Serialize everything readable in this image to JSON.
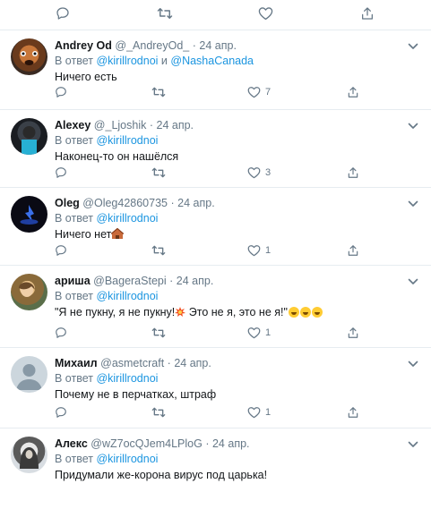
{
  "colors": {
    "accent": "#1b95e0",
    "muted": "#657786",
    "text": "#14171a",
    "divider": "#e6ecf0"
  },
  "tweets": [
    {
      "name": "Andrey Od",
      "handle": "@_AndreyOd_",
      "date": "24 апр.",
      "reply_prefix": "В ответ",
      "mention1": "@kirillrodnoi",
      "conj": "и",
      "mention2": "@NashaCanada",
      "text": "Ничего есть",
      "likes": "7"
    },
    {
      "name": "Alexey",
      "handle": "@_Ljoshik",
      "date": "24 апр.",
      "reply_prefix": "В ответ",
      "mention1": "@kirillrodnoi",
      "text": "Наконец-то он нашёлся",
      "likes": "3"
    },
    {
      "name": "Oleg",
      "handle": "@Oleg42860735",
      "date": "24 апр.",
      "reply_prefix": "В ответ",
      "mention1": "@kirillrodnoi",
      "text": "Ничего нет",
      "likes": "1"
    },
    {
      "name": "ариша",
      "handle": "@BageraStepi",
      "date": "24 апр.",
      "reply_prefix": "В ответ",
      "mention1": "@kirillrodnoi",
      "text_a": "\"Я не пукну, я не пукну!",
      "text_b": " Это не я, это не я!\"",
      "likes": "1"
    },
    {
      "name": "Михаил",
      "handle": "@asmetcraft",
      "date": "24 апр.",
      "reply_prefix": "В ответ",
      "mention1": "@kirillrodnoi",
      "text": "Почему не в перчатках, штраф",
      "likes": "1"
    },
    {
      "name": "Алекс",
      "handle": "@wZ7ocQJem4LPloG",
      "date": "24 апр.",
      "reply_prefix": "В ответ",
      "mention1": "@kirillrodnoi",
      "text": "Придумали же-корона вирус под царька!"
    }
  ],
  "dot": "·",
  "icons": [
    "reply-icon",
    "retweet-icon",
    "like-icon",
    "share-icon",
    "chevron-down-icon"
  ]
}
